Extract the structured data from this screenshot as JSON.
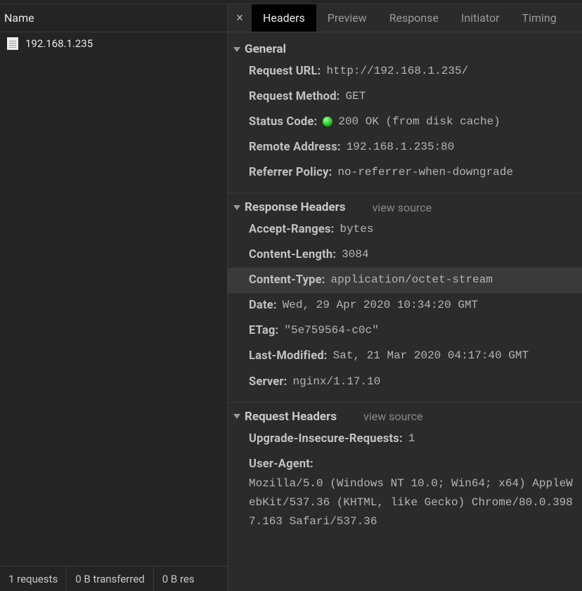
{
  "left": {
    "header": "Name",
    "items": [
      {
        "name": "192.168.1.235"
      }
    ],
    "footer": {
      "requests": "1 requests",
      "transferred": "0 B transferred",
      "resources": "0 B res"
    }
  },
  "tabs": {
    "close_glyph": "×",
    "items": [
      {
        "label": "Headers",
        "active": true
      },
      {
        "label": "Preview",
        "active": false
      },
      {
        "label": "Response",
        "active": false
      },
      {
        "label": "Initiator",
        "active": false
      },
      {
        "label": "Timing",
        "active": false
      }
    ]
  },
  "sections": {
    "general": {
      "title": "General",
      "rows": [
        {
          "label": "Request URL:",
          "value": "http://192.168.1.235/",
          "mono": true
        },
        {
          "label": "Request Method:",
          "value": "GET",
          "mono": true
        },
        {
          "label": "Status Code:",
          "value": "200 OK (from disk cache)",
          "status_dot": true,
          "mono": true
        },
        {
          "label": "Remote Address:",
          "value": "192.168.1.235:80",
          "mono": true
        },
        {
          "label": "Referrer Policy:",
          "value": "no-referrer-when-downgrade",
          "mono": true
        }
      ]
    },
    "response": {
      "title": "Response Headers",
      "view_source": "view source",
      "rows": [
        {
          "label": "Accept-Ranges:",
          "value": "bytes",
          "mono": true
        },
        {
          "label": "Content-Length:",
          "value": "3084",
          "mono": true
        },
        {
          "label": "Content-Type:",
          "value": "application/octet-stream",
          "mono": true,
          "highlight": true
        },
        {
          "label": "Date:",
          "value": "Wed, 29 Apr 2020 10:34:20 GMT",
          "mono": true
        },
        {
          "label": "ETag:",
          "value": "\"5e759564-c0c\"",
          "mono": true
        },
        {
          "label": "Last-Modified:",
          "value": "Sat, 21 Mar 2020 04:17:40 GMT",
          "mono": true
        },
        {
          "label": "Server:",
          "value": "nginx/1.17.10",
          "mono": true
        }
      ]
    },
    "request": {
      "title": "Request Headers",
      "view_source": "view source",
      "rows": [
        {
          "label": "Upgrade-Insecure-Requests:",
          "value": "1",
          "mono": true
        },
        {
          "label": "User-Agent:",
          "value": "Mozilla/5.0 (Windows NT 10.0; Win64; x64) AppleWebKit/537.36 (KHTML, like Gecko) Chrome/80.0.3987.163 Safari/537.36",
          "mono": true
        }
      ]
    }
  }
}
